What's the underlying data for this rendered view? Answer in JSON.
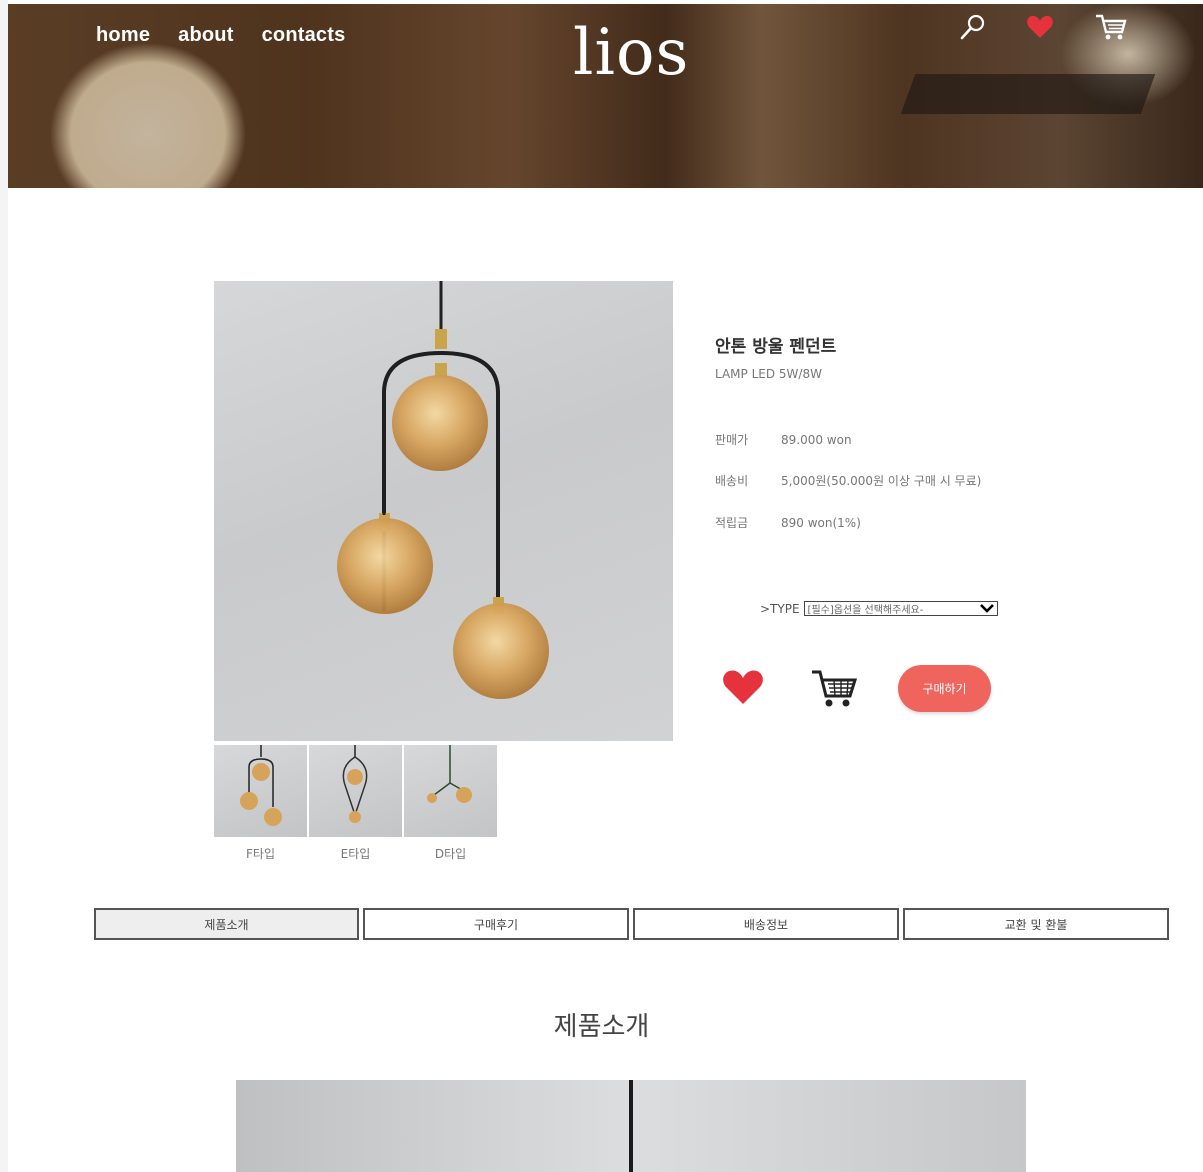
{
  "header": {
    "nav": [
      "home",
      "about",
      "contacts"
    ],
    "logo": "lios",
    "icons": [
      "search-icon",
      "heart-icon",
      "cart-icon"
    ]
  },
  "product": {
    "name": "안톤 방울 펜던트",
    "subtitle": "LAMP LED 5W/8W",
    "specs": [
      {
        "label": "판매가",
        "value": "89.000 won"
      },
      {
        "label": "배송비",
        "value": "5,000원(50.000원 이상 구매 시 무료)"
      },
      {
        "label": "적립금",
        "value": "890 won(1%)"
      }
    ],
    "type_label": ">TYPE",
    "type_select": "[필수]옵션을 선택해주세요-",
    "buy_label": "구매하기",
    "thumbs": [
      "F타입",
      "E타입",
      "D타입"
    ]
  },
  "tabs": [
    "제품소개",
    "구매후기",
    "배송정보",
    "교환 및 환불"
  ],
  "section": {
    "title": "제품소개"
  },
  "colors": {
    "accent": "#f0645e",
    "heart": "#e5323c"
  }
}
